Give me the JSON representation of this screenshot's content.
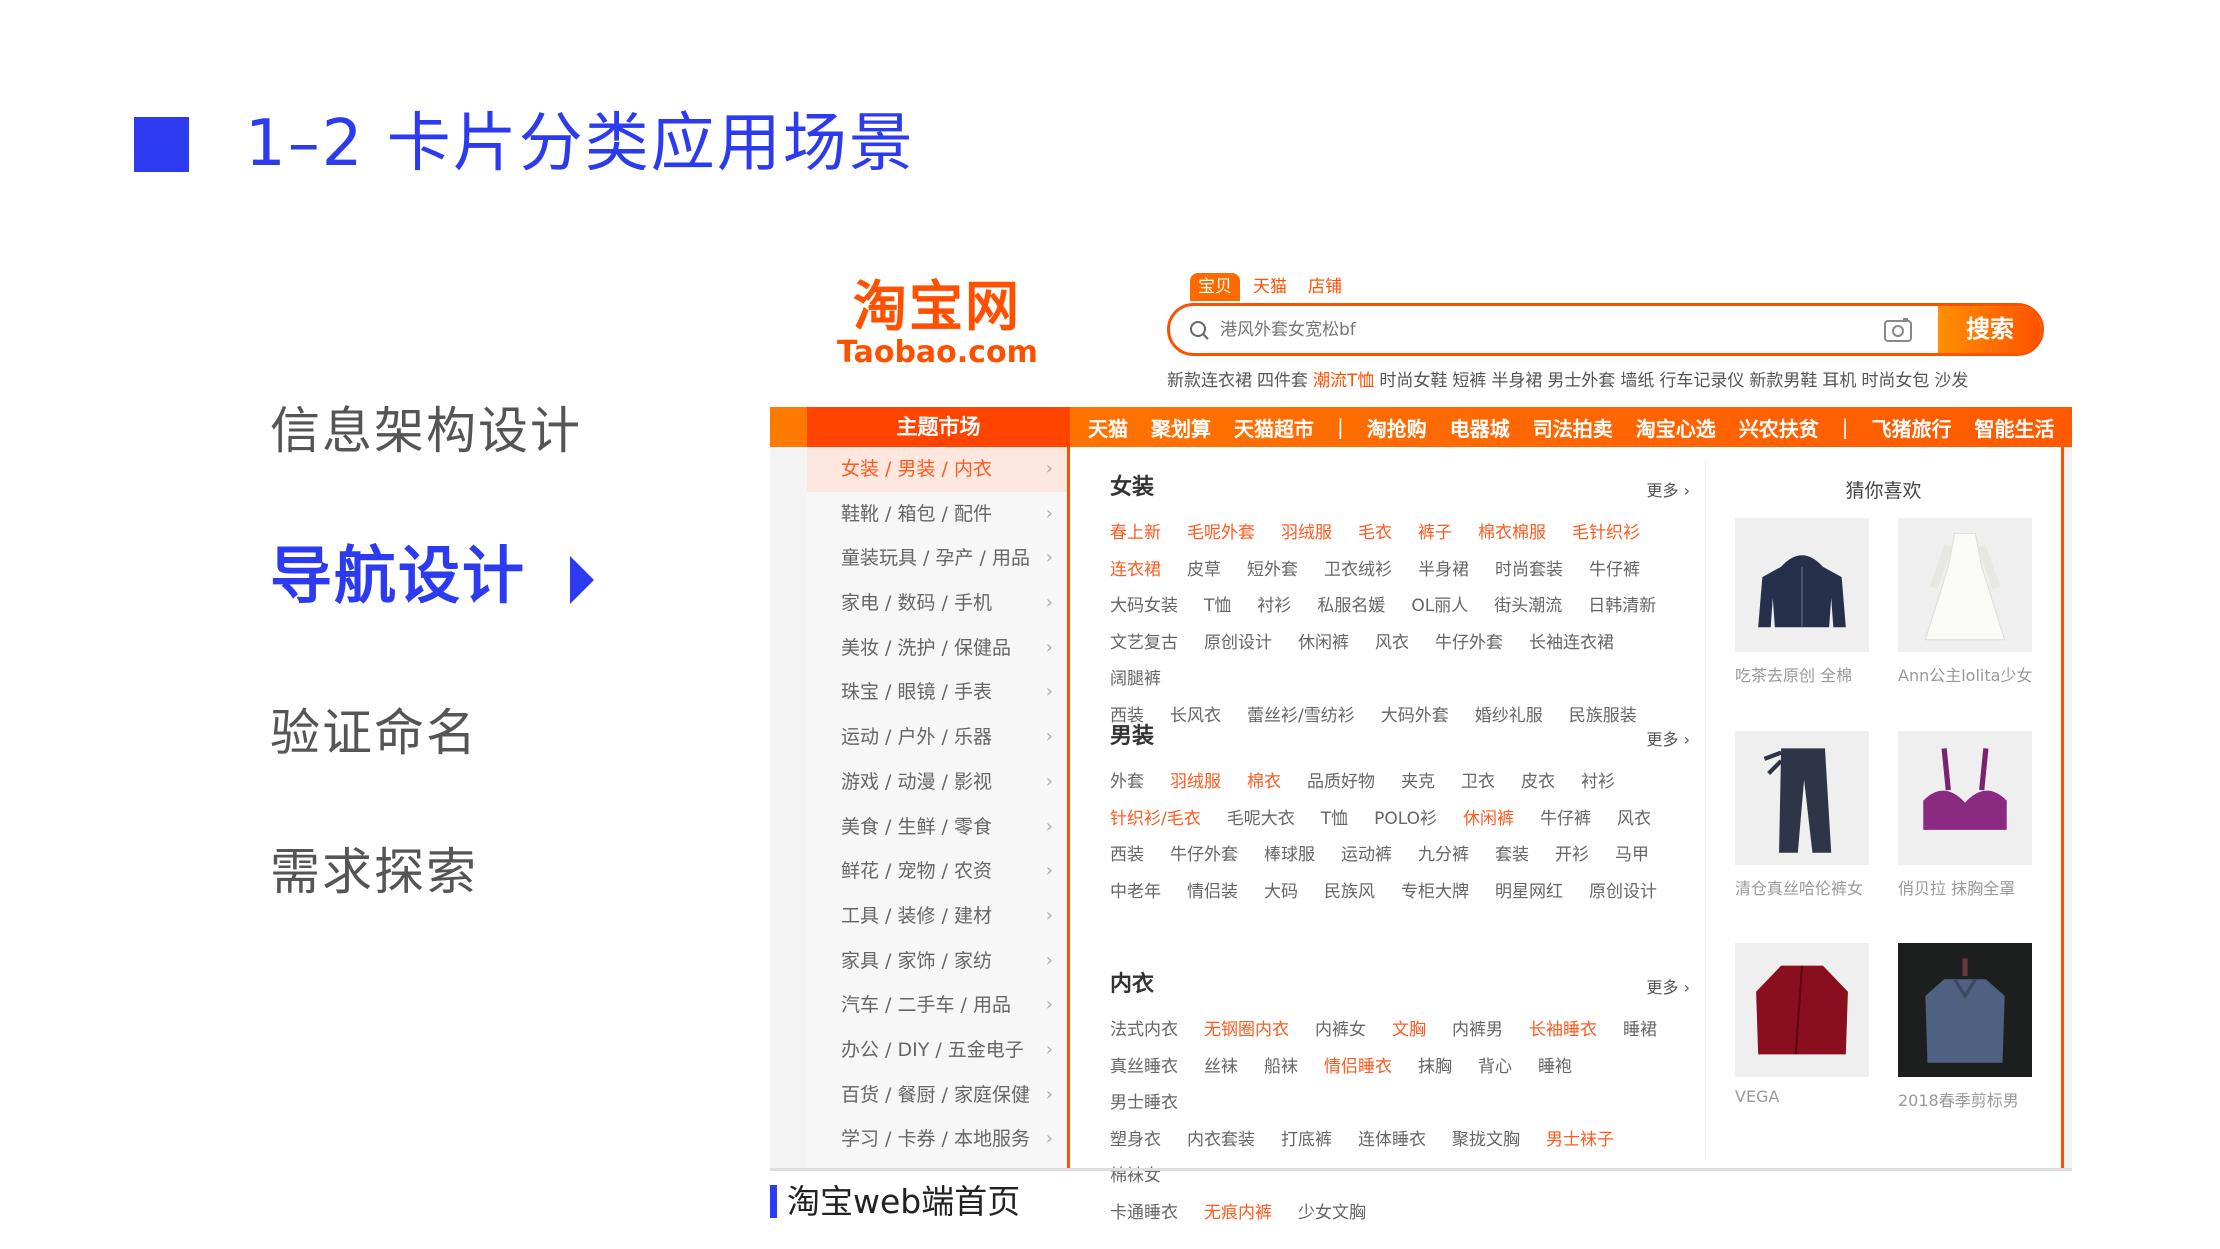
{
  "slide": {
    "title": "1–2 卡片分类应用场景",
    "menu": [
      {
        "label": "信息架构设计",
        "active": false
      },
      {
        "label": "导航设计",
        "active": true
      },
      {
        "label": "验证命名",
        "active": false
      },
      {
        "label": "需求探索",
        "active": false
      }
    ],
    "caption": "淘宝web端首页",
    "accent": "#2d3bf0"
  },
  "taobao": {
    "logo_cn": "淘宝网",
    "logo_en": "Taobao.com",
    "brand_color": "#ff5000",
    "search_tabs": [
      "宝贝",
      "天猫",
      "店铺"
    ],
    "search_placeholder": "港风外套女宽松bf",
    "search_button": "搜索",
    "hot_words": [
      {
        "text": "新款连衣裙"
      },
      {
        "text": "四件套"
      },
      {
        "text": "潮流T恤",
        "hot": true
      },
      {
        "text": "时尚女鞋"
      },
      {
        "text": "短裤"
      },
      {
        "text": "半身裙"
      },
      {
        "text": "男士外套"
      },
      {
        "text": "墙纸"
      },
      {
        "text": "行车记录仪"
      },
      {
        "text": "新款男鞋"
      },
      {
        "text": "耳机"
      },
      {
        "text": "时尚女包"
      },
      {
        "text": "沙发"
      }
    ],
    "nav_main": "主题市场",
    "nav_items": [
      "天猫",
      "聚划算",
      "天猫超市",
      "|",
      "淘抢购",
      "电器城",
      "司法拍卖",
      "淘宝心选",
      "兴农扶贫",
      "|",
      "飞猪旅行",
      "智能生活"
    ],
    "sidebar": [
      "女装 / 男装 / 内衣",
      "鞋靴 / 箱包 / 配件",
      "童装玩具 / 孕产 / 用品",
      "家电 / 数码 / 手机",
      "美妆 / 洗护 / 保健品",
      "珠宝 / 眼镜 / 手表",
      "运动 / 户外 / 乐器",
      "游戏 / 动漫 / 影视",
      "美食 / 生鲜 / 零食",
      "鲜花 / 宠物 / 农资",
      "工具 / 装修 / 建材",
      "家具 / 家饰 / 家纺",
      "汽车 / 二手车 / 用品",
      "办公 / DIY / 五金电子",
      "百货 / 餐厨 / 家庭保健",
      "学习 / 卡券 / 本地服务"
    ],
    "more_label": "更多",
    "categories": [
      {
        "title": "女装",
        "tags": [
          {
            "text": "春上新",
            "hot": true
          },
          {
            "text": "毛呢外套",
            "hot": true
          },
          {
            "text": "羽绒服",
            "hot": true
          },
          {
            "text": "毛衣",
            "hot": true
          },
          {
            "text": "裤子",
            "hot": true
          },
          {
            "text": "棉衣棉服",
            "hot": true
          },
          {
            "text": "毛针织衫",
            "hot": true
          },
          {
            "br": true
          },
          {
            "text": "连衣裙",
            "hot": true
          },
          {
            "text": "皮草"
          },
          {
            "text": "短外套"
          },
          {
            "text": "卫衣绒衫"
          },
          {
            "text": "半身裙"
          },
          {
            "text": "时尚套装"
          },
          {
            "text": "牛仔裤"
          },
          {
            "br": true
          },
          {
            "text": "大码女装"
          },
          {
            "text": "T恤"
          },
          {
            "text": "衬衫"
          },
          {
            "text": "私服名媛"
          },
          {
            "text": "OL丽人"
          },
          {
            "text": "街头潮流"
          },
          {
            "text": "日韩清新"
          },
          {
            "br": true
          },
          {
            "text": "文艺复古"
          },
          {
            "text": "原创设计"
          },
          {
            "text": "休闲裤"
          },
          {
            "text": "风衣"
          },
          {
            "text": "牛仔外套"
          },
          {
            "text": "长袖连衣裙"
          },
          {
            "text": "阔腿裤"
          },
          {
            "br": true
          },
          {
            "text": "西装"
          },
          {
            "text": "长风衣"
          },
          {
            "text": "蕾丝衫/雪纺衫"
          },
          {
            "text": "大码外套"
          },
          {
            "text": "婚纱礼服"
          },
          {
            "text": "民族服装"
          }
        ]
      },
      {
        "title": "男装",
        "tags": [
          {
            "text": "外套"
          },
          {
            "text": "羽绒服",
            "hot": true
          },
          {
            "text": "棉衣",
            "hot": true
          },
          {
            "text": "品质好物"
          },
          {
            "text": "夹克"
          },
          {
            "text": "卫衣"
          },
          {
            "text": "皮衣"
          },
          {
            "text": "衬衫"
          },
          {
            "br": true
          },
          {
            "text": "针织衫/毛衣",
            "hot": true
          },
          {
            "text": "毛呢大衣"
          },
          {
            "text": "T恤"
          },
          {
            "text": "POLO衫"
          },
          {
            "text": "休闲裤",
            "hot": true
          },
          {
            "text": "牛仔裤"
          },
          {
            "text": "风衣"
          },
          {
            "br": true
          },
          {
            "text": "西装"
          },
          {
            "text": "牛仔外套"
          },
          {
            "text": "棒球服"
          },
          {
            "text": "运动裤"
          },
          {
            "text": "九分裤"
          },
          {
            "text": "套装"
          },
          {
            "text": "开衫"
          },
          {
            "text": "马甲"
          },
          {
            "br": true
          },
          {
            "text": "中老年"
          },
          {
            "text": "情侣装"
          },
          {
            "text": "大码"
          },
          {
            "text": "民族风"
          },
          {
            "text": "专柜大牌"
          },
          {
            "text": "明星网红"
          },
          {
            "text": "原创设计"
          }
        ]
      },
      {
        "title": "内衣",
        "tags": [
          {
            "text": "法式内衣"
          },
          {
            "text": "无钢圈内衣",
            "hot": true
          },
          {
            "text": "内裤女"
          },
          {
            "text": "文胸",
            "hot": true
          },
          {
            "text": "内裤男"
          },
          {
            "text": "长袖睡衣",
            "hot": true
          },
          {
            "text": "睡裙"
          },
          {
            "br": true
          },
          {
            "text": "真丝睡衣"
          },
          {
            "text": "丝袜"
          },
          {
            "text": "船袜"
          },
          {
            "text": "情侣睡衣",
            "hot": true
          },
          {
            "text": "抹胸"
          },
          {
            "text": "背心"
          },
          {
            "text": "睡袍"
          },
          {
            "text": "男士睡衣"
          },
          {
            "br": true
          },
          {
            "text": "塑身衣"
          },
          {
            "text": "内衣套装"
          },
          {
            "text": "打底裤"
          },
          {
            "text": "连体睡衣"
          },
          {
            "text": "聚拢文胸"
          },
          {
            "text": "男士袜子",
            "hot": true
          },
          {
            "text": "棉袜女"
          },
          {
            "br": true
          },
          {
            "text": "卡通睡衣"
          },
          {
            "text": "无痕内裤",
            "hot": true
          },
          {
            "text": "少女文胸"
          }
        ]
      }
    ],
    "guess_title": "猜你喜欢",
    "products": [
      {
        "caption": "吃茶去原创 全棉",
        "icon": "hoodie-image"
      },
      {
        "caption": "Ann公主lolita少女",
        "icon": "dress-image"
      },
      {
        "caption": "清仓真丝哈伦裤女",
        "icon": "pants-image"
      },
      {
        "caption": "俏贝拉 抹胸全罩",
        "icon": "bra-image"
      },
      {
        "caption": "VEGA",
        "icon": "velvet-jacket-image"
      },
      {
        "caption": "2018春季剪标男",
        "icon": "jacket-image"
      }
    ]
  }
}
